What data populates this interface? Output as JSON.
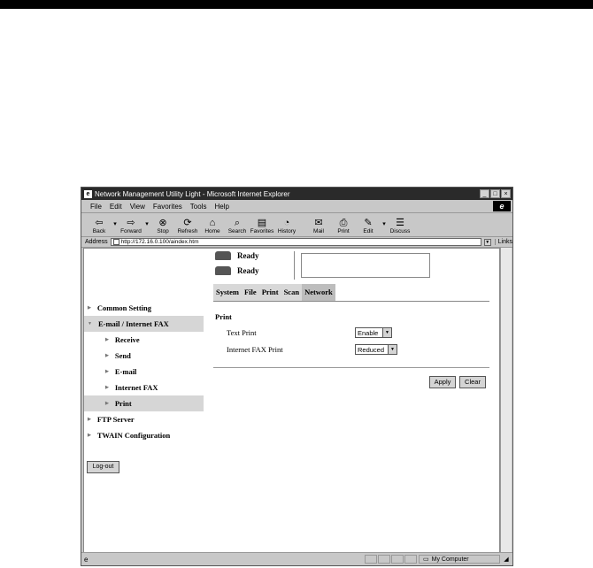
{
  "window": {
    "title": "Network Management Utility Light - Microsoft Internet Explorer"
  },
  "menu": [
    "File",
    "Edit",
    "View",
    "Favorites",
    "Tools",
    "Help"
  ],
  "toolbar": [
    {
      "label": "Back",
      "icon": "back-arrow-icon"
    },
    {
      "label": "Forward",
      "icon": "forward-arrow-icon"
    },
    {
      "label": "Stop",
      "icon": "stop-icon"
    },
    {
      "label": "Refresh",
      "icon": "refresh-icon"
    },
    {
      "label": "Home",
      "icon": "home-icon"
    },
    {
      "label": "Search",
      "icon": "search-icon"
    },
    {
      "label": "Favorites",
      "icon": "favorites-icon"
    },
    {
      "label": "History",
      "icon": "history-icon"
    },
    {
      "label": "Mail",
      "icon": "mail-icon"
    },
    {
      "label": "Print",
      "icon": "print-icon"
    },
    {
      "label": "Edit",
      "icon": "edit-icon"
    },
    {
      "label": "Discuss",
      "icon": "discuss-icon"
    }
  ],
  "address": {
    "label": "Address",
    "url": "http://172.16.0.100/aindex.htm",
    "links": "Links"
  },
  "status": {
    "printer": "Ready",
    "scanner": "Ready"
  },
  "tabs": [
    "System",
    "File",
    "Print",
    "Scan",
    "Network"
  ],
  "sidebar": {
    "items": [
      {
        "label": "Common Setting",
        "level": 0,
        "selected": false
      },
      {
        "label": "E-mail / Internet FAX",
        "level": 0,
        "selected": true
      },
      {
        "label": "Receive",
        "level": 1,
        "selected": false
      },
      {
        "label": "Send",
        "level": 1,
        "selected": false
      },
      {
        "label": "E-mail",
        "level": 1,
        "selected": false
      },
      {
        "label": "Internet FAX",
        "level": 1,
        "selected": false
      },
      {
        "label": "Print",
        "level": 1,
        "selected": true
      },
      {
        "label": "FTP Server",
        "level": 0,
        "selected": false
      },
      {
        "label": "TWAIN Configuration",
        "level": 0,
        "selected": false
      }
    ],
    "logout": "Log-out"
  },
  "form": {
    "title": "Print",
    "text_print_label": "Text Print",
    "text_print_value": "Enable",
    "ifax_print_label": "Internet FAX Print",
    "ifax_print_value": "Reduced",
    "apply": "Apply",
    "clear": "Clear"
  },
  "statusbar": {
    "zone": "My Computer"
  }
}
